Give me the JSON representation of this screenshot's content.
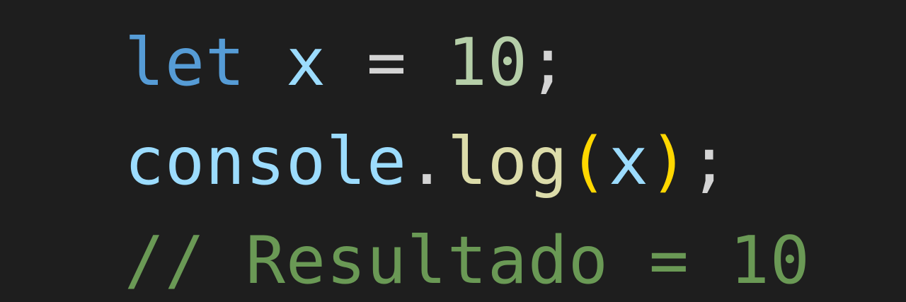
{
  "colors": {
    "background": "#1e1e1e",
    "keyword": "#569cd6",
    "variable": "#9cdcfe",
    "operator": "#d4d4d4",
    "number": "#b5cea8",
    "function": "#dcdcaa",
    "bracket": "#ffd700",
    "comment": "#6a9955"
  },
  "code": {
    "line1": {
      "keyword": "let",
      "sp1": " ",
      "variable": "x",
      "sp2": " ",
      "operator": "=",
      "sp3": " ",
      "number": "10",
      "semicolon": ";"
    },
    "line2": {
      "object": "console",
      "dot": ".",
      "method": "log",
      "paren_open": "(",
      "argument": "x",
      "paren_close": ")",
      "semicolon": ";"
    },
    "line3": {
      "comment": "// Resultado = 10"
    }
  }
}
